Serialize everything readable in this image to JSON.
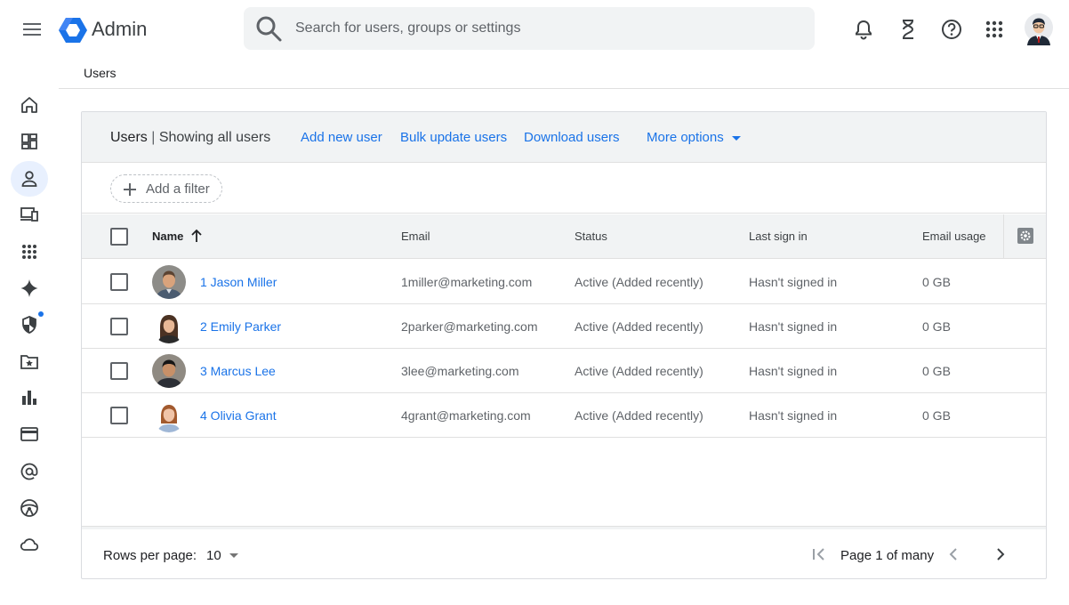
{
  "header": {
    "app_title": "Admin",
    "search_placeholder": "Search for users, groups or settings"
  },
  "breadcrumb": "Users",
  "nav": [
    {
      "icon": "home-icon"
    },
    {
      "icon": "dashboard-icon"
    },
    {
      "icon": "person-icon",
      "active": true
    },
    {
      "icon": "devices-icon"
    },
    {
      "icon": "apps-icon"
    },
    {
      "icon": "sparkle-icon"
    },
    {
      "icon": "security-shield-icon"
    },
    {
      "icon": "folder-star-icon"
    },
    {
      "icon": "reports-bar-chart-icon"
    },
    {
      "icon": "billing-card-icon"
    },
    {
      "icon": "at-sign-icon"
    },
    {
      "icon": "steering-wheel-icon"
    },
    {
      "icon": "cloud-icon"
    }
  ],
  "card": {
    "title_bold": "Users",
    "title_sep": " | ",
    "title_sub": "Showing all users",
    "actions": {
      "add": "Add new user",
      "bulk": "Bulk update users",
      "download": "Download users",
      "more": "More options"
    },
    "filter_label": "Add a filter"
  },
  "table": {
    "columns": {
      "name": "Name",
      "email": "Email",
      "status": "Status",
      "last_sign_in": "Last sign in",
      "email_usage": "Email usage"
    },
    "rows": [
      {
        "name": "1 Jason Miller",
        "email": "1miller@marketing.com",
        "status": "Active (Added recently)",
        "last_sign_in": "Hasn't signed in",
        "usage": "0 GB"
      },
      {
        "name": "2 Emily Parker",
        "email": "2parker@marketing.com",
        "status": "Active (Added recently)",
        "last_sign_in": "Hasn't signed in",
        "usage": "0 GB"
      },
      {
        "name": "3 Marcus Lee",
        "email": "3lee@marketing.com",
        "status": "Active (Added recently)",
        "last_sign_in": "Hasn't signed in",
        "usage": "0 GB"
      },
      {
        "name": "4 Olivia Grant",
        "email": "4grant@marketing.com",
        "status": "Active (Added recently)",
        "last_sign_in": "Hasn't signed in",
        "usage": "0 GB"
      }
    ]
  },
  "footer": {
    "rows_per_page_label": "Rows per page:",
    "rows_per_page_value": "10",
    "page_label": "Page 1 of many"
  },
  "colors": {
    "accent": "#1a73e8",
    "header_bg": "#f1f3f4"
  }
}
